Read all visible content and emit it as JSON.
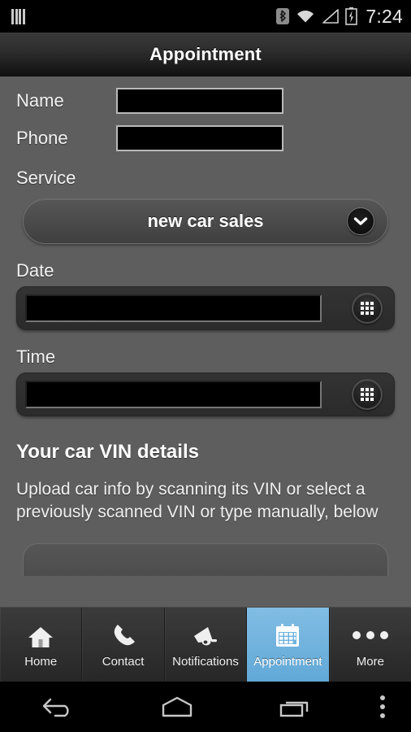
{
  "status_bar": {
    "left_icon": "sim-bars-icon",
    "icons": [
      "bluetooth-icon",
      "wifi-icon",
      "cellular-signal-icon",
      "battery-charging-icon"
    ],
    "time": "7:24"
  },
  "title_bar": {
    "title": "Appointment"
  },
  "form": {
    "name": {
      "label": "Name",
      "value": "",
      "placeholder": ""
    },
    "phone": {
      "label": "Phone",
      "value": "",
      "placeholder": ""
    },
    "service": {
      "label": "Service",
      "selected": "new car sales",
      "dropdown_icon": "chevron-down-icon"
    },
    "date": {
      "label": "Date",
      "value": "",
      "picker_icon": "calendar-grid-icon"
    },
    "time": {
      "label": "Time",
      "value": "",
      "picker_icon": "clock-grid-icon"
    }
  },
  "vin_section": {
    "heading": "Your car VIN details",
    "description": "Upload car info by scanning its VIN or select a previously scanned VIN or type manually, below"
  },
  "tab_bar": {
    "active_index": 3,
    "active_color": "#6fb2dd",
    "tabs": [
      {
        "label": "Home",
        "icon": "home-icon"
      },
      {
        "label": "Contact",
        "icon": "phone-icon"
      },
      {
        "label": "Notifications",
        "icon": "megaphone-icon"
      },
      {
        "label": "Appointment",
        "icon": "calendar-icon"
      },
      {
        "label": "More",
        "icon": "ellipsis-icon"
      }
    ]
  },
  "nav_bar": {
    "buttons": [
      {
        "name": "back",
        "icon": "back-arrow-icon"
      },
      {
        "name": "home",
        "icon": "home-pentagon-icon"
      },
      {
        "name": "recents",
        "icon": "recents-icon"
      },
      {
        "name": "menu",
        "icon": "overflow-menu-icon"
      }
    ]
  }
}
